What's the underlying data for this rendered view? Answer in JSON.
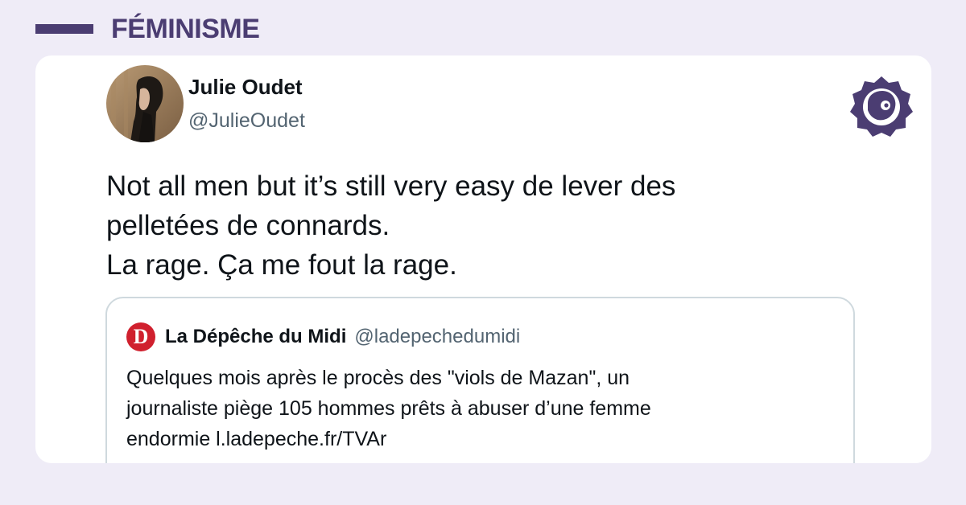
{
  "category": {
    "label": "FÉMINISME"
  },
  "tweet": {
    "author_name": "Julie Oudet",
    "author_handle": "@JulieOudet",
    "text_lines": [
      "Not all men but it’s still very easy de lever des",
      "pelletées de connards.",
      "La rage. Ça me fout la rage."
    ]
  },
  "quoted_tweet": {
    "avatar_letter": "D",
    "author_name": "La Dépêche du Midi",
    "author_handle": "@ladepechedumidi",
    "text_lines": [
      "Quelques mois après le procès des \"viols de Mazan\", un",
      "journaliste piège 105 hommes prêts à abuser d’une femme",
      "endormie l.ladepeche.fr/TVAr"
    ]
  },
  "colors": {
    "background": "#efecf7",
    "accent": "#4b3d72",
    "quote_avatar": "#d0202e"
  },
  "icons": {
    "brand": "brand-logo-icon",
    "quote_avatar": "ladepeche-logo-icon"
  }
}
